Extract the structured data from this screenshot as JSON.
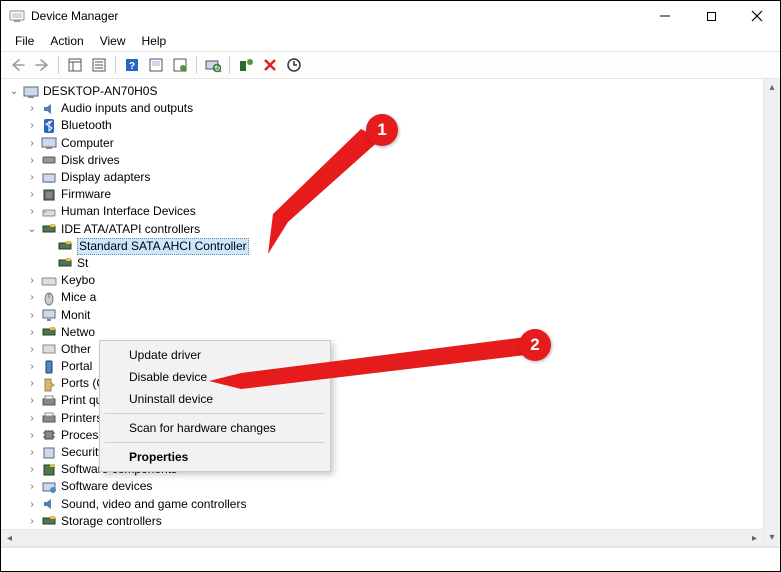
{
  "window": {
    "title": "Device Manager"
  },
  "menu": {
    "file": "File",
    "action": "Action",
    "view": "View",
    "help": "Help"
  },
  "tree": {
    "root": "DESKTOP-AN70H0S",
    "items": [
      "Audio inputs and outputs",
      "Bluetooth",
      "Computer",
      "Disk drives",
      "Display adapters",
      "Firmware",
      "Human Interface Devices",
      "IDE ATA/ATAPI controllers",
      "Standard SATA AHCI Controller",
      "St",
      "Keybo",
      "Mice a",
      "Monit",
      "Netwo",
      "Other",
      "Portal",
      "Ports (COM & LPT)",
      "Print queues",
      "Printers",
      "Processors",
      "Security devices",
      "Software components",
      "Software devices",
      "Sound, video and game controllers",
      "Storage controllers"
    ]
  },
  "ctx": {
    "update": "Update driver",
    "disable": "Disable device",
    "uninstall": "Uninstall device",
    "scan": "Scan for hardware changes",
    "properties": "Properties"
  },
  "callouts": {
    "one": "1",
    "two": "2"
  }
}
